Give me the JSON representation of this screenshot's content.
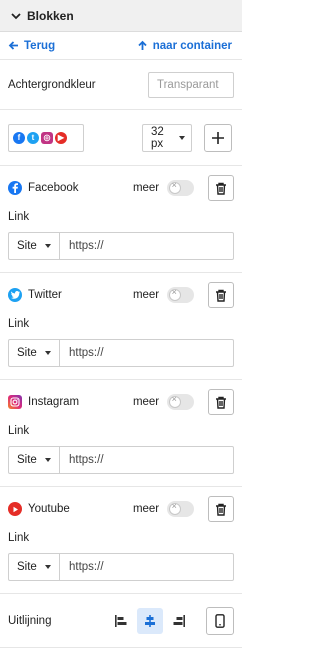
{
  "header": {
    "title": "Blokken"
  },
  "nav": {
    "back_label": "Terug",
    "parent_label": "naar container"
  },
  "background": {
    "label": "Achtergrondkleur",
    "value": "Transparant"
  },
  "icons": {
    "size": "32 px"
  },
  "socials": [
    {
      "name": "Facebook",
      "more_label": "meer",
      "link_label": "Link",
      "type": "Site",
      "url": "https://",
      "color": "#1877f2"
    },
    {
      "name": "Twitter",
      "more_label": "meer",
      "link_label": "Link",
      "type": "Site",
      "url": "https://",
      "color": "#1da1f2"
    },
    {
      "name": "Instagram",
      "more_label": "meer",
      "link_label": "Link",
      "type": "Site",
      "url": "https://",
      "color": "#c13584"
    },
    {
      "name": "Youtube",
      "more_label": "meer",
      "link_label": "Link",
      "type": "Site",
      "url": "https://",
      "color": "#e52d27"
    }
  ],
  "alignment": {
    "label": "Uitlijning",
    "selected": "center"
  },
  "colors": {
    "accent": "#1b6fd6",
    "active_bg": "#dbe9fb"
  }
}
